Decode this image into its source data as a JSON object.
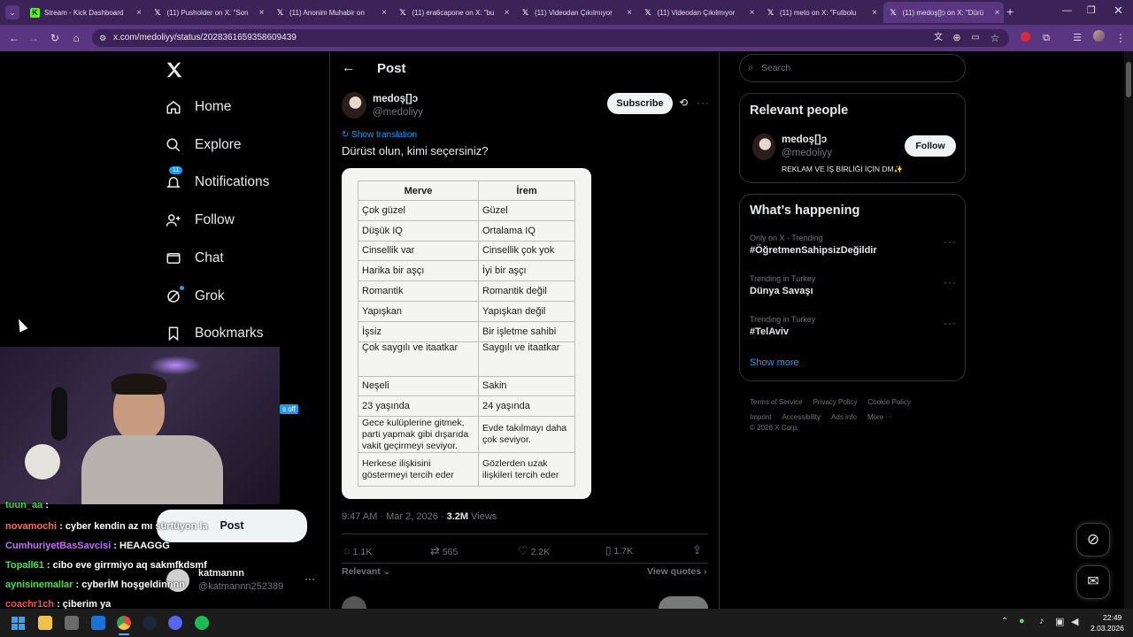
{
  "browser": {
    "tabs": [
      {
        "title": "Stream - Kick Dashboard",
        "favicon": "kick-icon",
        "active": false
      },
      {
        "title": "(11) Pusholder on X: \"Son",
        "favicon": "x-logo-icon",
        "active": false
      },
      {
        "title": "(11) Anonim Muhabir on",
        "favicon": "x-logo-icon",
        "active": false
      },
      {
        "title": "(11) era6capone on X: \"bu",
        "favicon": "x-logo-icon",
        "active": false
      },
      {
        "title": "(11) Videodan Çıkılmıyor",
        "favicon": "x-logo-icon",
        "active": false
      },
      {
        "title": "(11) Videodan Çıkılmıyor",
        "favicon": "x-logo-icon",
        "active": false
      },
      {
        "title": "(11) meto on X: \"Futbolu",
        "favicon": "x-logo-icon",
        "active": false
      },
      {
        "title": "(11) medoş[]ɔ on X: \"Dürü",
        "favicon": "x-logo-icon",
        "active": true
      }
    ],
    "url": "x.com/medoliyy/status/2028361659358609439",
    "accent": "#5a3580"
  },
  "sidebar": {
    "logo": "x-logo-icon",
    "items": [
      {
        "label": "Home",
        "icon": "home-icon"
      },
      {
        "label": "Explore",
        "icon": "search-icon"
      },
      {
        "label": "Notifications",
        "icon": "bell-icon",
        "badge": "11"
      },
      {
        "label": "Follow",
        "icon": "person-plus-icon"
      },
      {
        "label": "Chat",
        "icon": "mail-icon"
      },
      {
        "label": "Grok",
        "icon": "grok-icon"
      },
      {
        "label": "Bookmarks",
        "icon": "bookmark-icon"
      }
    ],
    "post_button": "Post",
    "account": {
      "name": "katmannn",
      "handle": "@katmannn252389"
    },
    "partial_badge": "s off"
  },
  "main": {
    "header": "Post",
    "author": {
      "name": "medoş[]ɔ",
      "handle": "@medoliyy"
    },
    "subscribe": "Subscribe",
    "show_translation": "Show translation",
    "text": "Dürüst olun, kimi seçersiniz?",
    "table": {
      "headers": [
        "Merve",
        "İrem"
      ],
      "rows": [
        [
          "Çok güzel",
          "Güzel"
        ],
        [
          "Düşük IQ",
          "Ortalama IQ"
        ],
        [
          "Cinsellik var",
          "Cinsellik çok yok"
        ],
        [
          "Harika bir aşçı",
          "İyi bir aşçı"
        ],
        [
          "Romantik",
          "Romantik değil"
        ],
        [
          "Yapışkan",
          "Yapışkan değil"
        ],
        [
          "İşsiz",
          "Bir işletme sahibi"
        ],
        [
          "Çok saygılı ve itaatkar",
          "Saygılı ve itaatkar"
        ],
        [
          "Neşeli",
          "Sakin"
        ],
        [
          "23 yaşında",
          "24 yaşında"
        ],
        [
          "Gece kulüplerine gitmek, parti yapmak gibi dışarıda vakit geçirmeyi seviyor.",
          "Evde takılmayı daha çok seviyor."
        ],
        [
          "Herkese ilişkisini göstermeyi tercih eder",
          "Gözlerden uzak ilişkileri tercih eder"
        ]
      ]
    },
    "timestamp": "9:47 AM · Mar 2, 2026 · ",
    "views_count": "3.2M",
    "views_label": " Views",
    "actions": {
      "replies": "1.1K",
      "reposts": "565",
      "likes": "2.2K",
      "bookmarks": "1.7K"
    },
    "sort": "Relevant",
    "view_quotes": "View quotes"
  },
  "right": {
    "search_placeholder": "Search",
    "relevant_title": "Relevant people",
    "person": {
      "name": "medoş[]ɔ",
      "handle": "@medoliyy",
      "bio": "REKLAM VE İŞ BİRLİĞİ İÇİN DM✨"
    },
    "follow": "Follow",
    "happening_title": "What’s happening",
    "trends": [
      {
        "context": "Only on X · Trending",
        "name": "#ÖğretmenSahipsizDeğildir"
      },
      {
        "context": "Trending in Turkey",
        "name": "Dünya Savaşı"
      },
      {
        "context": "Trending in Turkey",
        "name": "#TelAviv"
      }
    ],
    "show_more": "Show more",
    "footer": [
      "Terms of Service",
      "Privacy Policy",
      "Cookie Policy",
      "Imprint",
      "Accessibility",
      "Ads info",
      "More ···"
    ],
    "copyright": "© 2026 X Corp."
  },
  "overlay": {
    "chat": [
      {
        "user": "tuun_aa",
        "msg": " :",
        "color": "#3fd14a"
      },
      {
        "user": "novamochi",
        "msg": " : cyber kendin az mı sürtüyon la",
        "color": "#ff6a5a"
      },
      {
        "user": "CumhuriyetBasSavcisi",
        "msg": " : HEAAGGG",
        "color": "#c86bff"
      },
      {
        "user": "Topall61",
        "msg": " : cibo eve girrmiyo aq sakmfkdsmf",
        "color": "#47e04f"
      },
      {
        "user": "aynisinemallar",
        "msg": " : cyberİM hoşgeldinnnn",
        "color": "#47e04f"
      },
      {
        "user": "coachr1ch",
        "msg": " : çiberim ya",
        "color": "#ff4b4b"
      }
    ]
  },
  "taskbar": {
    "time": "22:49",
    "date": "2.03.2026"
  }
}
